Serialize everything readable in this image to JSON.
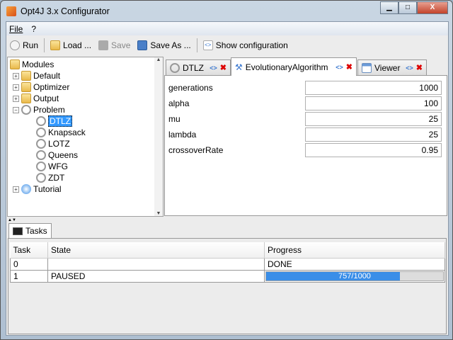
{
  "window": {
    "title": "Opt4J 3.x Configurator",
    "minimize": "▁",
    "maximize": "□",
    "close": "X"
  },
  "menu": [
    "File",
    "?"
  ],
  "toolbar": {
    "run": "Run",
    "load": "Load ...",
    "save": "Save",
    "save_as": "Save As ...",
    "show_config": "Show configuration"
  },
  "tree": {
    "root": "Modules",
    "items": [
      {
        "label": "Default",
        "level": 1
      },
      {
        "label": "Optimizer",
        "level": 1
      },
      {
        "label": "Output",
        "level": 1
      },
      {
        "label": "Problem",
        "level": 1,
        "expanded": true
      },
      {
        "label": "DTLZ",
        "level": 2,
        "selected": true
      },
      {
        "label": "Knapsack",
        "level": 2
      },
      {
        "label": "LOTZ",
        "level": 2
      },
      {
        "label": "Queens",
        "level": 2
      },
      {
        "label": "WFG",
        "level": 2
      },
      {
        "label": "ZDT",
        "level": 2
      },
      {
        "label": "Tutorial",
        "level": 1
      }
    ]
  },
  "tabs": [
    {
      "label": "DTLZ"
    },
    {
      "label": "EvolutionaryAlgorithm",
      "active": true
    },
    {
      "label": "Viewer"
    }
  ],
  "params": [
    {
      "label": "generations",
      "value": "1000"
    },
    {
      "label": "alpha",
      "value": "100"
    },
    {
      "label": "mu",
      "value": "25"
    },
    {
      "label": "lambda",
      "value": "25"
    },
    {
      "label": "crossoverRate",
      "value": "0.95"
    }
  ],
  "tasks": {
    "tab": "Tasks",
    "columns": [
      "Task",
      "State",
      "Progress"
    ],
    "rows": [
      {
        "task": "0",
        "state": "",
        "progress": "DONE"
      },
      {
        "task": "1",
        "state": "PAUSED",
        "progress": "757/1000",
        "fraction": 0.757
      }
    ]
  }
}
